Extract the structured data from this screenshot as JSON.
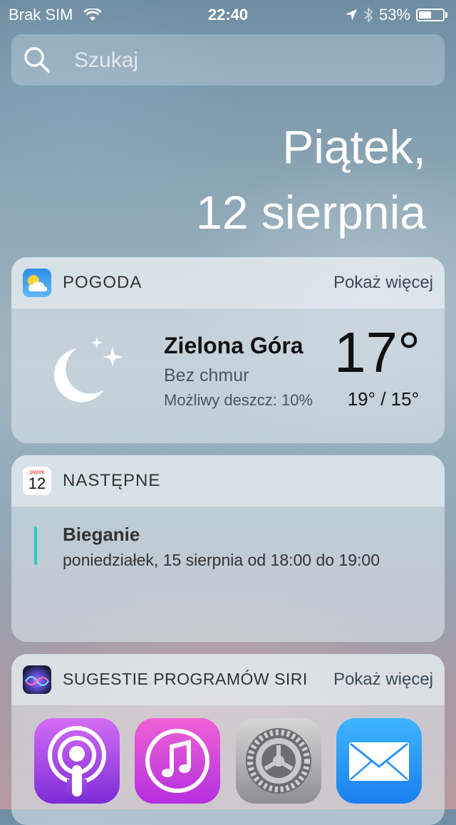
{
  "status": {
    "carrier": "Brak SIM",
    "time": "22:40",
    "battery": "53%",
    "battery_level": 0.53
  },
  "search": {
    "placeholder": "Szukaj"
  },
  "date": {
    "line1": "Piątek,",
    "line2": "12 sierpnia"
  },
  "weather": {
    "title": "POGODA",
    "more": "Pokaż więcej",
    "city": "Zielona Góra",
    "condition": "Bez chmur",
    "rain": "Możliwy deszcz: 10%",
    "temp": "17°",
    "hilo": "19° / 15°"
  },
  "upnext": {
    "title": "NASTĘPNE",
    "icon_day": "piątek",
    "icon_date": "12",
    "event_title": "Bieganie",
    "event_time": "poniedziałek, 15 sierpnia od 18:00 do 19:00"
  },
  "siri": {
    "title": "SUGESTIE PROGRAMÓW SIRI",
    "more": "Pokaż więcej",
    "apps": [
      "podcasts-icon",
      "itunes-store-icon",
      "settings-icon",
      "mail-icon"
    ]
  }
}
